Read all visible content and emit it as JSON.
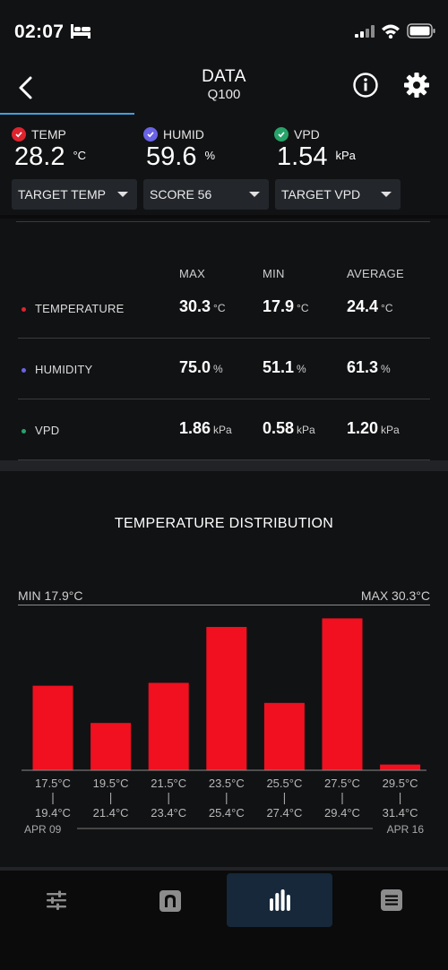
{
  "status_bar": {
    "time": "02:07",
    "icons": [
      "bed-icon",
      "signal-icon",
      "wifi-icon",
      "battery-icon"
    ]
  },
  "header": {
    "title": "DATA",
    "subtitle": "Q100",
    "back_icon": "chevron-left-icon",
    "info_icon": "info-icon",
    "settings_icon": "gear-icon",
    "accent": "#3ea1e0"
  },
  "readings": [
    {
      "label": "TEMP",
      "value": "28.2",
      "unit": "°C",
      "color": "#e0242f"
    },
    {
      "label": "HUMID",
      "value": "59.6",
      "unit": "%",
      "color": "#6a63e6"
    },
    {
      "label": "VPD",
      "value": "1.54",
      "unit": "kPa",
      "color": "#27a36a"
    }
  ],
  "dropdowns": [
    {
      "label": "TARGET TEMP"
    },
    {
      "label": "SCORE 56"
    },
    {
      "label": "TARGET VPD"
    }
  ],
  "stats": {
    "columns": [
      "MAX",
      "MIN",
      "AVERAGE"
    ],
    "rows": [
      {
        "name": "TEMPERATURE",
        "color": "#e0242f",
        "max": "30.3",
        "min": "17.9",
        "avg": "24.4",
        "unit": "°C"
      },
      {
        "name": "HUMIDITY",
        "color": "#6a63e6",
        "max": "75.0",
        "min": "51.1",
        "avg": "61.3",
        "unit": "%"
      },
      {
        "name": "VPD",
        "color": "#27a36a",
        "max": "1.86",
        "min": "0.58",
        "avg": "1.20",
        "unit": "kPa"
      }
    ]
  },
  "distribution": {
    "title": "TEMPERATURE DISTRIBUTION",
    "min_label": "MIN 17.9°C",
    "max_label": "MAX 30.3°C",
    "date_start": "APR 09",
    "date_end": "APR 16"
  },
  "chart_data": {
    "type": "bar",
    "title": "TEMPERATURE DISTRIBUTION",
    "categories": [
      "17.5°C–19.4°C",
      "19.5°C–21.4°C",
      "21.5°C–23.4°C",
      "23.5°C–25.4°C",
      "25.5°C–27.4°C",
      "27.5°C–29.4°C",
      "29.5°C–31.4°C"
    ],
    "bin_low": [
      "17.5°C",
      "19.5°C",
      "21.5°C",
      "23.5°C",
      "25.5°C",
      "27.5°C",
      "29.5°C"
    ],
    "bin_high": [
      "19.4°C",
      "21.4°C",
      "23.4°C",
      "25.4°C",
      "27.4°C",
      "29.4°C",
      "31.4°C"
    ],
    "values": [
      0.59,
      0.33,
      0.61,
      1.0,
      0.47,
      1.06,
      0.04
    ],
    "value_scale": "relative (no y-axis printed)",
    "bar_color": "#f0101f",
    "grid": false,
    "legend": "none"
  },
  "tabbar": {
    "tabs": [
      {
        "name": "tab-controls",
        "icon": "sliders-icon",
        "active": false
      },
      {
        "name": "tab-automation",
        "icon": "automation-icon",
        "active": false
      },
      {
        "name": "tab-data",
        "icon": "bar-chart-icon",
        "active": true
      },
      {
        "name": "tab-log",
        "icon": "list-icon",
        "active": false
      }
    ]
  }
}
